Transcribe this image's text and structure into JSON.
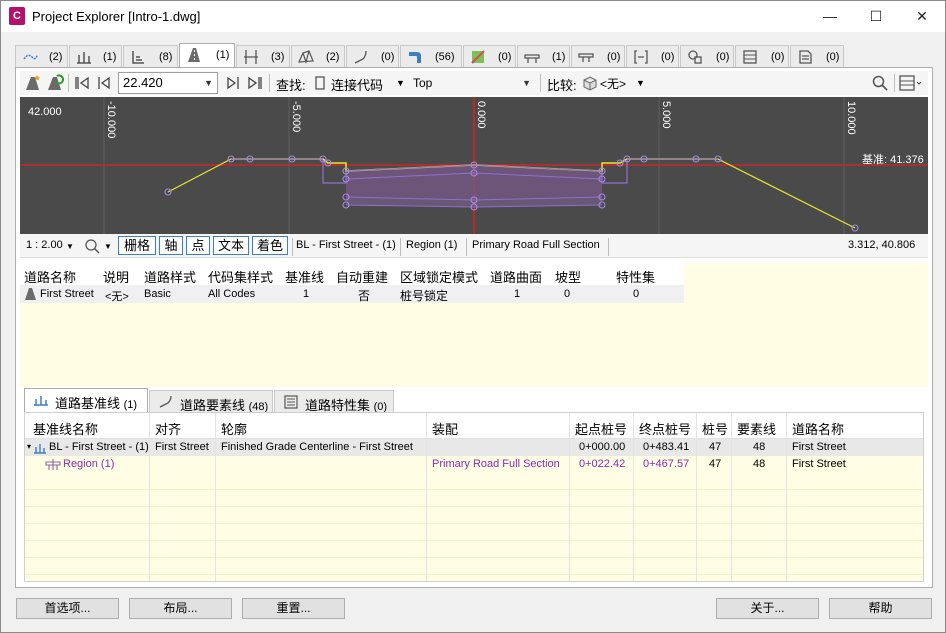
{
  "window": {
    "title": "Project Explorer [Intro-1.dwg]",
    "app_icon_letter": "C",
    "minimize": "—",
    "maximize": "☐",
    "close": "✕"
  },
  "tabs": [
    {
      "icon": "alignment-icon",
      "count": "(2)"
    },
    {
      "icon": "profile-icon",
      "count": "(1)"
    },
    {
      "icon": "profile-view-icon",
      "count": "(8)"
    },
    {
      "icon": "corridor-icon",
      "count": "(1)"
    },
    {
      "icon": "sample-lines-icon",
      "count": "(3)"
    },
    {
      "icon": "surface-icon",
      "count": "(2)"
    },
    {
      "icon": "feature-line-icon",
      "count": "(0)"
    },
    {
      "icon": "pipe-network-icon",
      "count": "(56)"
    },
    {
      "icon": "parcel-icon",
      "count": "(0)"
    },
    {
      "icon": "assembly-icon",
      "count": "(1)"
    },
    {
      "icon": "subassembly-icon",
      "count": "(0)"
    },
    {
      "icon": "section-icon",
      "count": "(0)"
    },
    {
      "icon": "point-group-icon",
      "count": "(0)"
    },
    {
      "icon": "table-icon",
      "count": "(0)"
    },
    {
      "icon": "report-icon",
      "count": "(0)"
    }
  ],
  "toolbar": {
    "station_value": "22.420",
    "find_label": "查找:",
    "find_value": "连接代码",
    "find_target": "Top",
    "compare_label": "比较:",
    "compare_value": "<无>"
  },
  "viewport": {
    "elevation_label": "42.000",
    "offset_ticks": [
      "-10.000",
      "-5.000",
      "0.000",
      "5.000",
      "10.000"
    ],
    "datum_label": "基准: 41.376"
  },
  "statusbar": {
    "scale": "1 : 2.00",
    "toggles": [
      "栅格",
      "轴",
      "点",
      "文本",
      "着色"
    ],
    "baseline": "BL - First Street - (1)",
    "region": "Region (1)",
    "assembly": "Primary Road Full Section",
    "coords": "3.312, 40.806"
  },
  "corridor_grid": {
    "headers": [
      "道路名称",
      "说明",
      "道路样式",
      "代码集样式",
      "基准线",
      "自动重建",
      "区域锁定模式",
      "道路曲面",
      "坡型",
      "特性集"
    ],
    "row": [
      "First Street",
      "<无>",
      "Basic",
      "All Codes",
      "1",
      "否",
      "桩号锁定",
      "1",
      "0",
      "0"
    ]
  },
  "subtabs": [
    {
      "icon": "baseline-icon",
      "label": "道路基准线",
      "count": "(1)"
    },
    {
      "icon": "feature-line-icon",
      "label": "道路要素线",
      "count": "(48)"
    },
    {
      "icon": "property-set-icon",
      "label": "道路特性集",
      "count": "(0)"
    }
  ],
  "baseline_grid": {
    "headers": [
      "基准线名称",
      "对齐",
      "轮廓",
      "装配",
      "起点桩号",
      "终点桩号",
      "桩号",
      "要素线",
      "道路名称"
    ],
    "rows": [
      [
        "BL - First Street - (1)",
        "First Street",
        "Finished Grade Centerline - First Street",
        "",
        "0+000.00",
        "0+483.41",
        "47",
        "48",
        "First Street"
      ],
      [
        "Region (1)",
        "",
        "",
        "Primary Road Full Section",
        "0+022.42",
        "0+467.57",
        "47",
        "48",
        "First Street"
      ]
    ]
  },
  "buttons": {
    "options": "首选项...",
    "layout": "布局...",
    "reset": "重置...",
    "about": "关于...",
    "help": "帮助"
  },
  "colors": {
    "viewport_bg": "#4a4a4a",
    "axis_red": "#e02020",
    "subassembly_purple": "#8f6fd0",
    "daylight_yellow": "#e8e830",
    "region_text": "#8b2bb5",
    "selected_blue": "#3c7fc4"
  }
}
